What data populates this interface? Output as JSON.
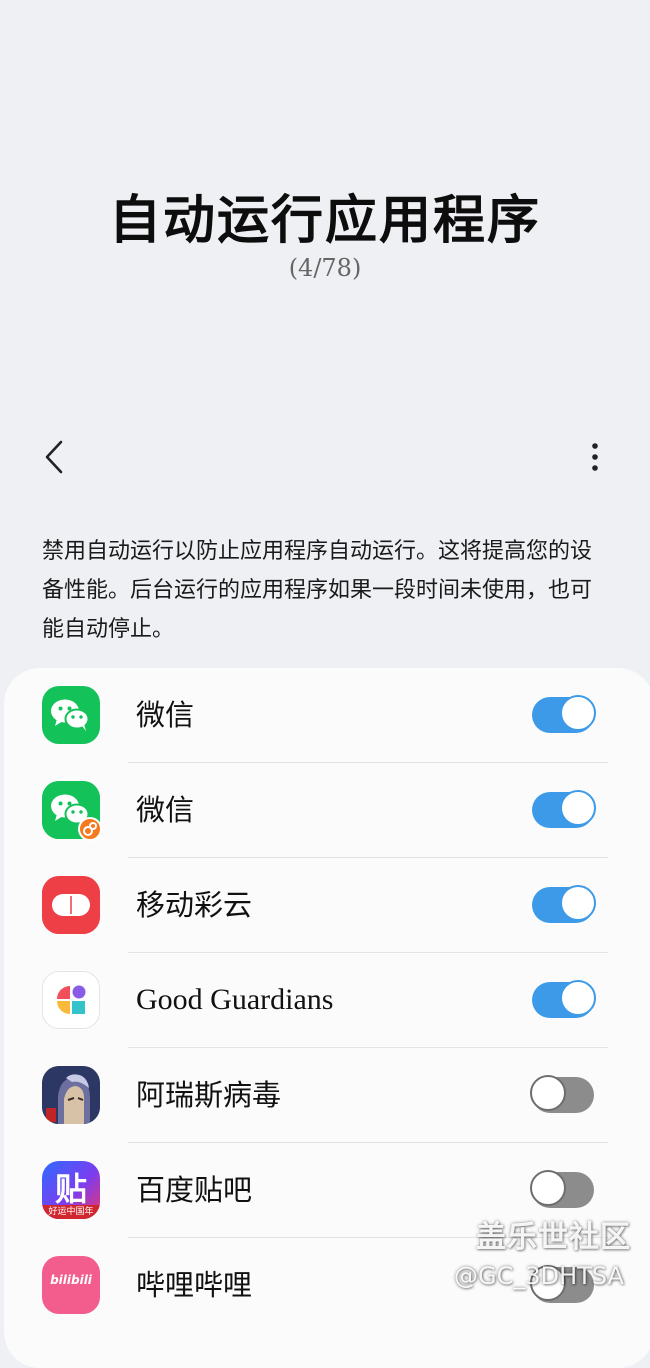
{
  "header": {
    "title": "自动运行应用程序",
    "count": "(4/78)"
  },
  "toolbar": {
    "back_icon": "back-arrow-icon",
    "more_icon": "more-vertical-icon"
  },
  "description": "禁用自动运行以防止应用程序自动运行。这将提高您的设备性能。后台运行的应用程序如果一段时间未使用，也可能自动停止。",
  "apps": [
    {
      "name": "微信",
      "icon": "wechat-icon",
      "enabled": true
    },
    {
      "name": "微信",
      "icon": "wechat-dual-icon",
      "enabled": true
    },
    {
      "name": "移动彩云",
      "icon": "mcloud-icon",
      "enabled": true
    },
    {
      "name": "Good Guardians",
      "icon": "good-guardians-icon",
      "enabled": true
    },
    {
      "name": "阿瑞斯病毒",
      "icon": "ares-virus-icon",
      "enabled": false
    },
    {
      "name": "百度贴吧",
      "icon": "baidu-tieba-icon",
      "enabled": false
    },
    {
      "name": "哔哩哔哩",
      "icon": "bilibili-icon",
      "enabled": false
    }
  ],
  "icon_text": {
    "tieba_glyph": "贴",
    "tieba_caption": "好运中国年",
    "bilibili_logo": "bilibili"
  },
  "colors": {
    "accent": "#3d9ae8",
    "background": "#eef0f3",
    "card": "#fbfbfc"
  },
  "watermark": {
    "title": "盖乐世社区",
    "user": "@GC_3DHTSA"
  }
}
